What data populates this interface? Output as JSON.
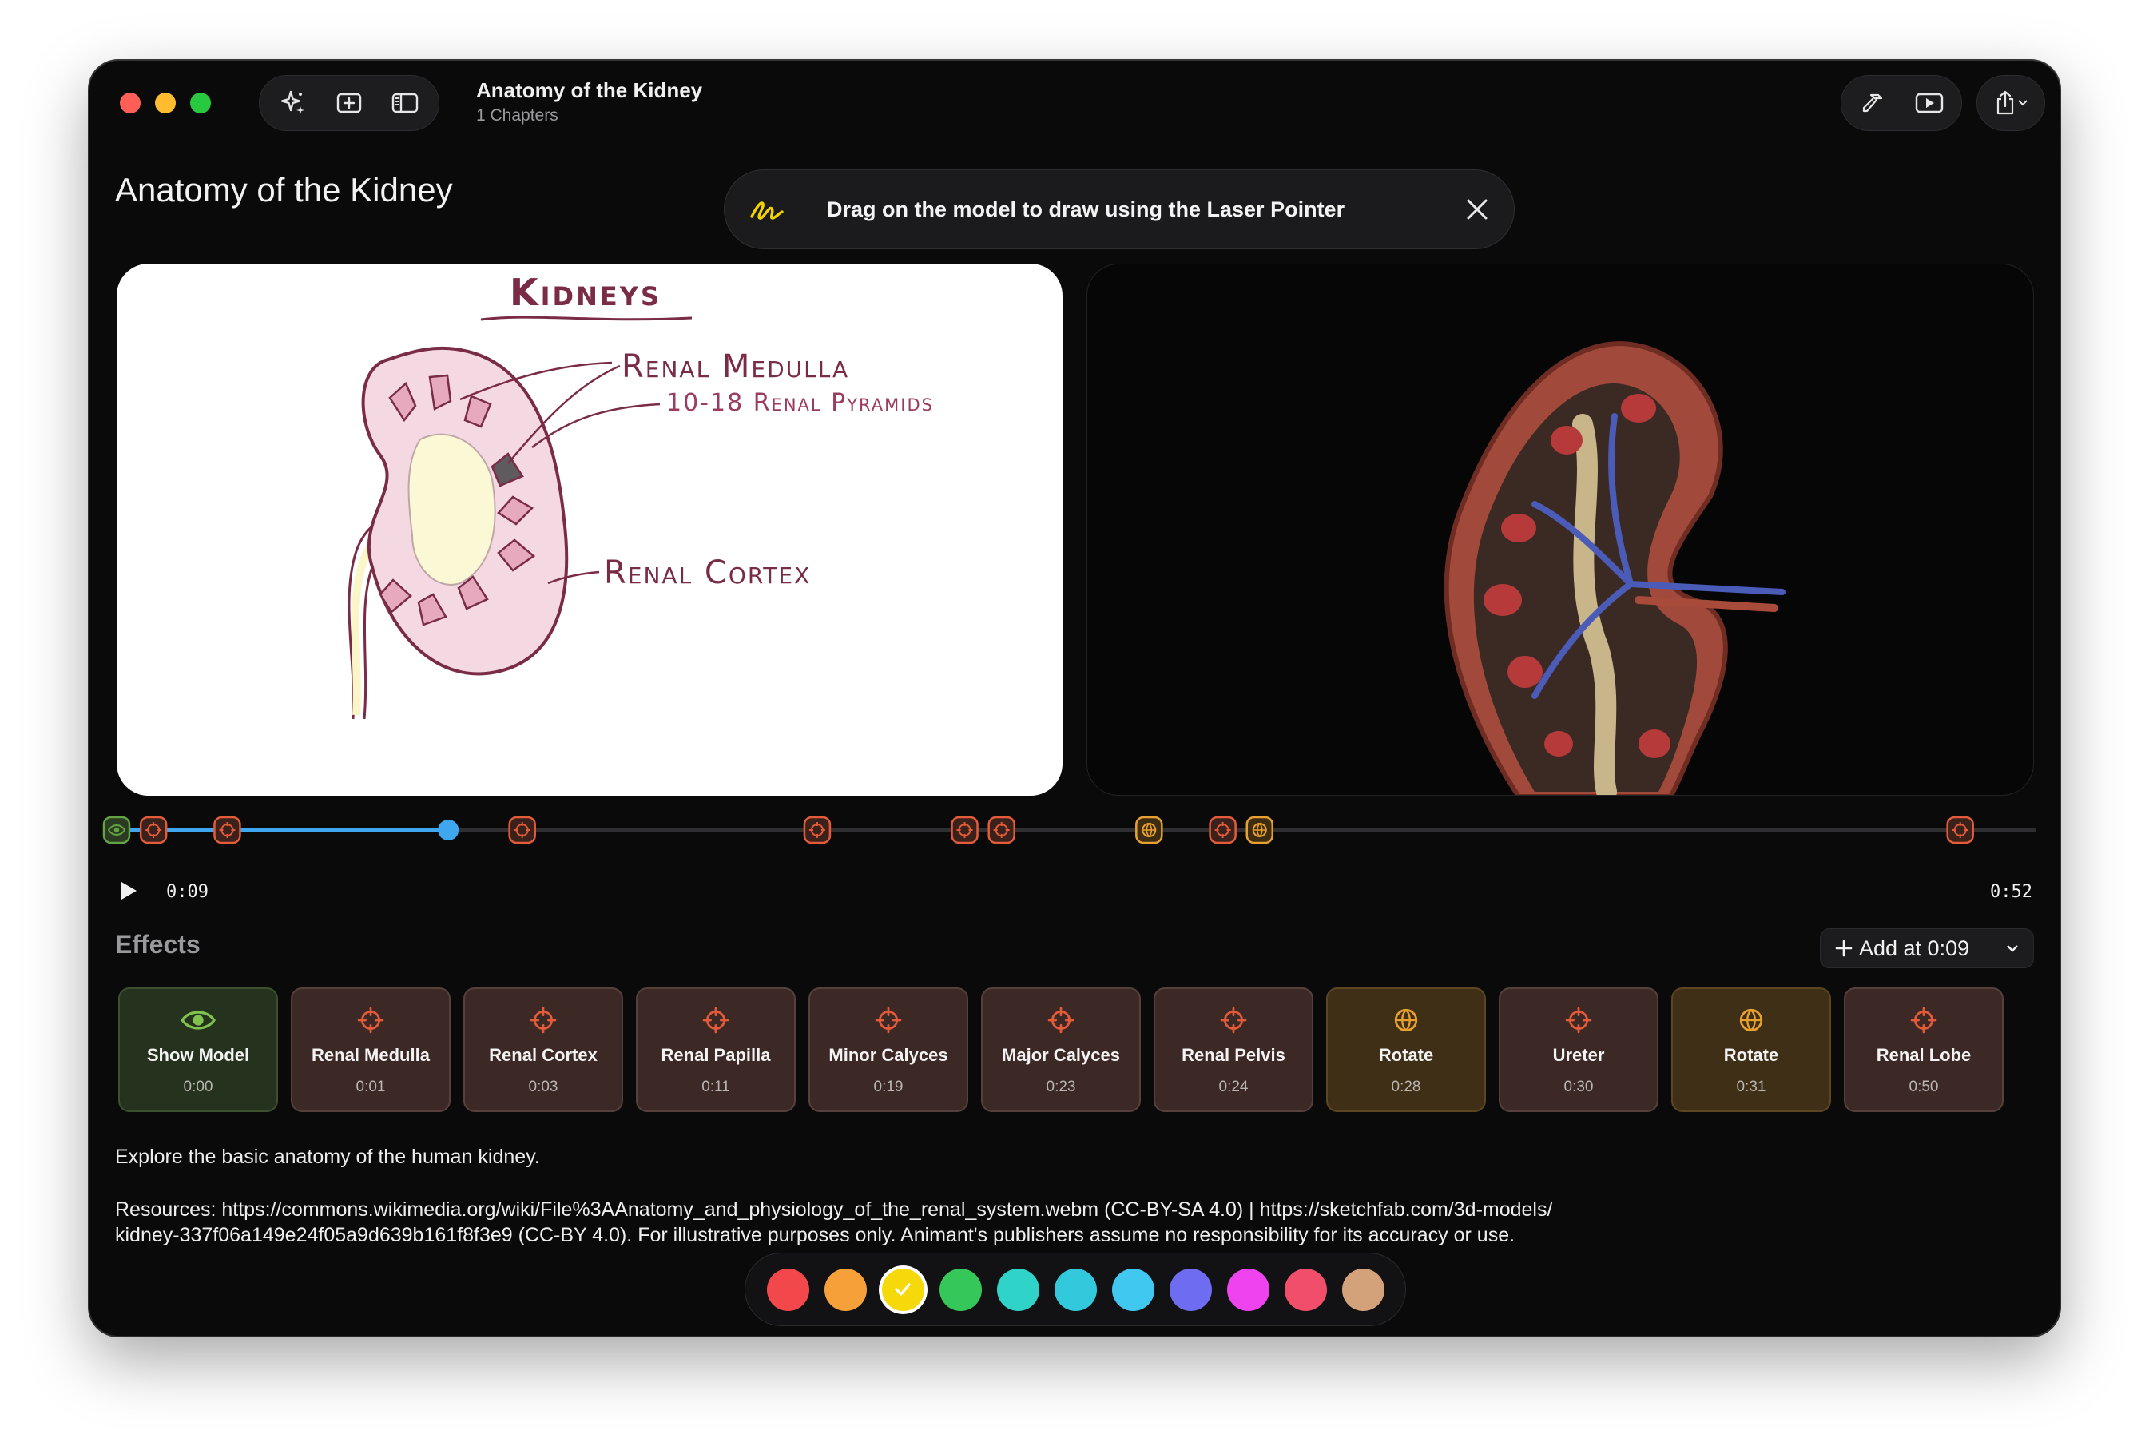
{
  "window": {
    "title": "Anatomy of the Kidney",
    "subtitle": "1 Chapters"
  },
  "page_title": "Anatomy of the Kidney",
  "toast": {
    "message": "Drag on the model to draw using the Laser Pointer"
  },
  "diagram": {
    "heading": "Kidneys",
    "labels": {
      "medulla": "Renal Medulla",
      "pyramids": "10-18 Renal Pyramids",
      "cortex": "Renal Cortex"
    }
  },
  "playback": {
    "current_time": "0:09",
    "total_time": "0:52",
    "progress": 0.173
  },
  "effects": {
    "heading": "Effects",
    "add_label": "Add at 0:09",
    "items": [
      {
        "label": "Show Model",
        "time": "0:00",
        "kind": "model",
        "icon": "eye-icon"
      },
      {
        "label": "Renal Medulla",
        "time": "0:01",
        "kind": "focus",
        "icon": "crosshair-icon"
      },
      {
        "label": "Renal Cortex",
        "time": "0:03",
        "kind": "focus",
        "icon": "crosshair-icon"
      },
      {
        "label": "Renal Papilla",
        "time": "0:11",
        "kind": "focus",
        "icon": "crosshair-icon"
      },
      {
        "label": "Minor Calyces",
        "time": "0:19",
        "kind": "focus",
        "icon": "crosshair-icon"
      },
      {
        "label": "Major Calyces",
        "time": "0:23",
        "kind": "focus",
        "icon": "crosshair-icon"
      },
      {
        "label": "Renal Pelvis",
        "time": "0:24",
        "kind": "focus",
        "icon": "crosshair-icon"
      },
      {
        "label": "Rotate",
        "time": "0:28",
        "kind": "rotate",
        "icon": "globe-icon"
      },
      {
        "label": "Ureter",
        "time": "0:30",
        "kind": "focus",
        "icon": "crosshair-icon"
      },
      {
        "label": "Rotate",
        "time": "0:31",
        "kind": "rotate",
        "icon": "globe-icon"
      },
      {
        "label": "Renal Lobe",
        "time": "0:50",
        "kind": "focus",
        "icon": "crosshair-icon"
      }
    ]
  },
  "description": "Explore the basic anatomy of the human kidney.",
  "resources_line1": "Resources: https://commons.wikimedia.org/wiki/File%3AAnatomy_and_physiology_of_the_renal_system.webm (CC-BY-SA 4.0) | https://sketchfab.com/3d-models/",
  "resources_line2": "kidney-337f06a149e24f05a9d639b161f8f3e9 (CC-BY 4.0). For illustrative purposes only. Animant's publishers assume no responsibility for its accuracy or use.",
  "palette": {
    "colors": [
      "#f2484b",
      "#f6a03a",
      "#f5d90a",
      "#35c759",
      "#2fd3c7",
      "#33c9dc",
      "#40c8f0",
      "#6e6cf0",
      "#ee43ee",
      "#f04e6a",
      "#d4a27a"
    ],
    "selected": 2
  },
  "colors": {
    "accent": "#3fa7ef",
    "focus_marker": "#e35b38",
    "rotate_marker": "#e8a030",
    "model_marker": "#61a442"
  }
}
